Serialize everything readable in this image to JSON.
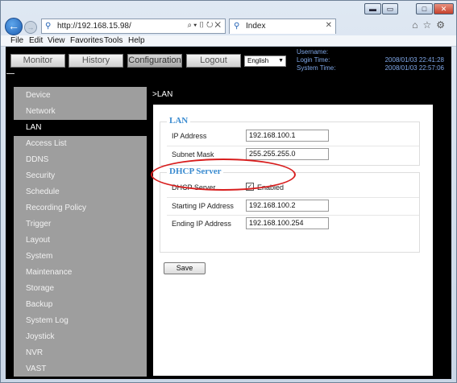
{
  "browser": {
    "address": "http://192.168.15.98/",
    "tab_title": "Index",
    "menu": [
      "File",
      "Edit",
      "View",
      "Favorites",
      "Tools",
      "Help"
    ]
  },
  "topnav": {
    "tabs": [
      "Monitor",
      "History",
      "Configuration",
      "Logout"
    ],
    "language": "English",
    "username_label": "Username:",
    "username_value": "",
    "login_time_label": "Login Time:",
    "login_time_value": "2008/01/03 22:41:28",
    "system_time_label": "System Time:",
    "system_time_value": "2008/01/03 22:57:06"
  },
  "sidebar": {
    "items": [
      "Device",
      "Network",
      "LAN",
      "Access List",
      "DDNS",
      "Security",
      "Schedule",
      "Recording Policy",
      "Trigger",
      "Layout",
      "System",
      "Maintenance",
      "Storage",
      "Backup",
      "System Log",
      "Joystick",
      "NVR",
      "VAST"
    ],
    "active": "LAN"
  },
  "content": {
    "breadcrumb": ">LAN",
    "lan_legend": "LAN",
    "ip_label": "IP Address",
    "ip_value": "192.168.100.1",
    "mask_label": "Subnet Mask",
    "mask_value": "255.255.255.0",
    "dhcp_legend": "DHCP Server",
    "dhcp_label": "DHCP Server",
    "dhcp_enabled_label": "Enabled",
    "start_label": "Starting IP Address",
    "start_value": "192.168.100.2",
    "end_label": "Ending IP Address",
    "end_value": "192.168.100.254",
    "save_label": "Save"
  },
  "colors": {
    "accent_legend": "#3a8bd0",
    "highlight_circle": "#d81e1e",
    "status_text": "#7fa7e8"
  }
}
